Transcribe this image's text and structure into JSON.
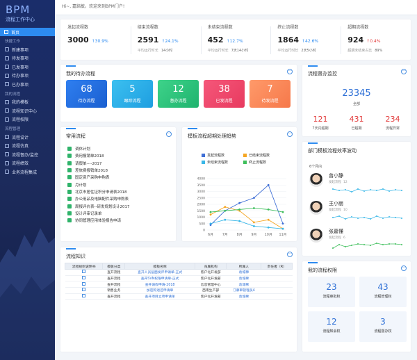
{
  "sidebar": {
    "logo": "BPM",
    "logo_sub": "流程工作中心",
    "home": "首页",
    "sections": [
      {
        "title": "快捷工作",
        "items": [
          "新建事项",
          "待发事项",
          "已发事项",
          "待办事项",
          "已办事项"
        ]
      },
      {
        "title": "我的流程",
        "items": [
          "我的模板",
          "流程知识中心",
          "流程权限"
        ]
      },
      {
        "title": "流程管理",
        "items": [
          "流程设计",
          "流程仿真",
          "流程督办/监控",
          "流程绩效",
          "业务流程集成"
        ]
      }
    ]
  },
  "topbar": {
    "greeting": "Hi~, 嘉銘敏，欢迎来到BPM门户!"
  },
  "stats": [
    {
      "label": "发起流程数",
      "value": "3000",
      "pct": "30.9%",
      "dir": "up",
      "sub": "",
      "sub_val": ""
    },
    {
      "label": "结束流程数",
      "value": "2591",
      "pct": "24.1%",
      "dir": "up",
      "sub": "平均运行时长",
      "sub_val": "14小时"
    },
    {
      "label": "未结束流程数",
      "value": "452",
      "pct": "12.7%",
      "dir": "up",
      "sub": "平均运行时长",
      "sub_val": "7天14小时"
    },
    {
      "label": "终止流程数",
      "value": "1864",
      "pct": "42.6%",
      "dir": "up",
      "sub": "平均运行时长",
      "sub_val": "2天5小时"
    },
    {
      "label": "超期流程数",
      "value": "924",
      "pct": "0.4%",
      "dir": "up",
      "sub": "超期未结束占比",
      "sub_val": "89%"
    }
  ],
  "todo": {
    "title": "我的待办流程",
    "tiles": [
      {
        "value": "68",
        "label": "待办流程"
      },
      {
        "value": "5",
        "label": "跟踪流程"
      },
      {
        "value": "12",
        "label": "督办流程"
      },
      {
        "value": "38",
        "label": "已发流程"
      },
      {
        "value": "7",
        "label": "待发流程"
      }
    ]
  },
  "monitor": {
    "title": "流程督办监控",
    "total": "23345",
    "total_label": "全部",
    "items": [
      {
        "value": "121",
        "label": "7天内超期",
        "color": "#e23b3b"
      },
      {
        "value": "431",
        "label": "已超期",
        "color": "#e23b3b"
      },
      {
        "value": "234",
        "label": "流程异常",
        "color": "#e23b3b"
      }
    ]
  },
  "common": {
    "title": "常用流程",
    "items": [
      "调休计划",
      "费用报销单2018",
      "请假单----2017",
      "差旅费报销单2018",
      "固定资产采购申购表",
      "月计划",
      "北京市居住证积分申请表2018",
      "办公用品及电脑配件采购申购表",
      "周报评价表--研发规划设计2017",
      "设计评审记录单",
      "协同管理应用体验报告申请"
    ]
  },
  "chart_data": {
    "type": "line",
    "title": "模板流程超期处理趋势",
    "categories": [
      "6月",
      "7月",
      "8月",
      "9月",
      "10月",
      "11月"
    ],
    "ylim": [
      0,
      4000
    ],
    "yticks": [
      0,
      500,
      1000,
      1500,
      2000,
      2500,
      3000,
      3500,
      4000
    ],
    "series": [
      {
        "name": "发起流程数",
        "color": "#3f6fd6",
        "values": [
          400,
          1500,
          2100,
          2500,
          3500,
          500
        ]
      },
      {
        "name": "已结束流程数",
        "color": "#f5a623",
        "values": [
          1200,
          1800,
          1500,
          600,
          800,
          100
        ]
      },
      {
        "name": "未结束流程数",
        "color": "#39b7e8",
        "values": [
          500,
          800,
          700,
          300,
          200,
          100
        ]
      },
      {
        "name": "终止流程数",
        "color": "#3fbf5c",
        "values": [
          1400,
          1500,
          1600,
          1700,
          1600,
          1400
        ]
      }
    ]
  },
  "efficiency": {
    "title": "部门模板流程效率波动",
    "period": "6个月内",
    "people": [
      {
        "name": "曾小静",
        "label": "发起流程",
        "count": "12"
      },
      {
        "name": "王小丽",
        "label": "发起流程",
        "count": "10"
      },
      {
        "name": "张嘉懂",
        "label": "发起流程",
        "count": "6"
      }
    ]
  },
  "knowledge": {
    "title": "流程知识",
    "headers": [
      "流程规则说明书",
      "模板分类",
      "模板名称",
      "归属机构",
      "所属人",
      "责任者（R）"
    ],
    "rows": [
      [
        "",
        "查开流程",
        "查开人员层面发评申请单-正式",
        "客户化开发部",
        "袁城稀",
        ""
      ],
      [
        "",
        "查开流程",
        "查开SVN权限申请单-正式",
        "客户化开发部",
        "袁城稀",
        ""
      ],
      [
        "",
        "查开流程",
        "查开请假申请-2018",
        "信息管理中心",
        "袁城稀",
        ""
      ],
      [
        "",
        "销售业务",
        "加密狗退还申请单",
        "西南生产部",
        "汀慕审管理员4",
        ""
      ],
      [
        "",
        "查开流程",
        "查开项目立项申请单",
        "客户化开发部",
        "袁城稀",
        ""
      ]
    ]
  },
  "permissions": {
    "title": "我的流程权限",
    "items": [
      {
        "value": "23",
        "label": "流程审批权"
      },
      {
        "value": "43",
        "label": "流程管理权"
      },
      {
        "value": "12",
        "label": "流程知会权"
      },
      {
        "value": "3",
        "label": "流程督办权"
      }
    ]
  }
}
